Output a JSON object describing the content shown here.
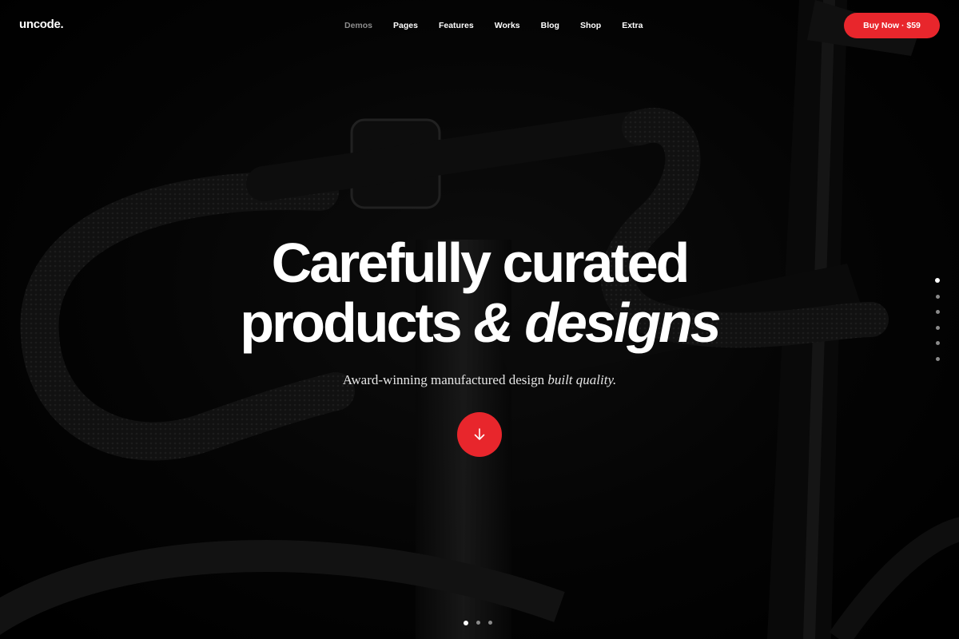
{
  "brand": {
    "logo": "uncode."
  },
  "nav": {
    "items": [
      {
        "label": "Demos",
        "active": true
      },
      {
        "label": "Pages"
      },
      {
        "label": "Features"
      },
      {
        "label": "Works"
      },
      {
        "label": "Blog"
      },
      {
        "label": "Shop"
      },
      {
        "label": "Extra"
      }
    ]
  },
  "cta": {
    "buy_label": "Buy Now · $59"
  },
  "hero": {
    "headline_line1": "Carefully curated",
    "headline_line2_plain": "products ",
    "headline_line2_accent": "& designs",
    "subtitle_plain": "Award-winning manufactured design ",
    "subtitle_em": "built quality.",
    "scroll_icon": "arrow-down-icon"
  },
  "slider": {
    "side_dots": 6,
    "side_active_index": 0,
    "bottom_dots": 3,
    "bottom_active_index": 0
  },
  "colors": {
    "accent": "#e8262c",
    "background": "#000000",
    "nav_active": "#8c8c8c"
  }
}
